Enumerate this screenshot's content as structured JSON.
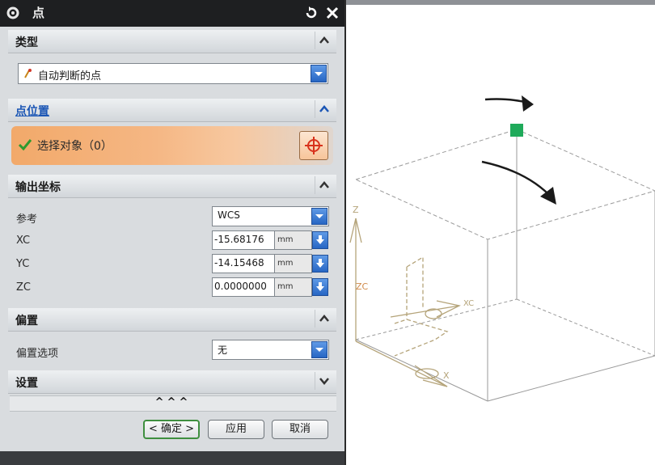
{
  "dialog": {
    "title": "点",
    "sections": {
      "type": {
        "label": "类型",
        "value": "自动判断的点"
      },
      "point_location": {
        "label": "点位置",
        "select_label": "选择对象（0）"
      },
      "output_coords": {
        "label": "输出坐标",
        "reference_label": "参考",
        "reference_value": "WCS",
        "rows": [
          {
            "label": "XC",
            "value": "-15.68176",
            "unit": "mm"
          },
          {
            "label": "YC",
            "value": "-14.15468",
            "unit": "mm"
          },
          {
            "label": "ZC",
            "value": "0.0000000",
            "unit": "mm"
          }
        ]
      },
      "offset": {
        "label": "偏置",
        "option_label": "偏置选项",
        "option_value": "无"
      },
      "settings": {
        "label": "设置"
      }
    },
    "expand_glyph": "^^^",
    "buttons": {
      "ok": "< 确定 >",
      "apply": "应用",
      "cancel": "取消"
    }
  },
  "viewport": {
    "axis_labels": {
      "z": "Z",
      "zc": "ZC",
      "xc": "XC",
      "x": "X"
    },
    "colors": {
      "marker": "#1faa5a",
      "axes": "#b5a47a",
      "cube": "#9a9a9a",
      "arrow": "#1a1a1a"
    }
  }
}
